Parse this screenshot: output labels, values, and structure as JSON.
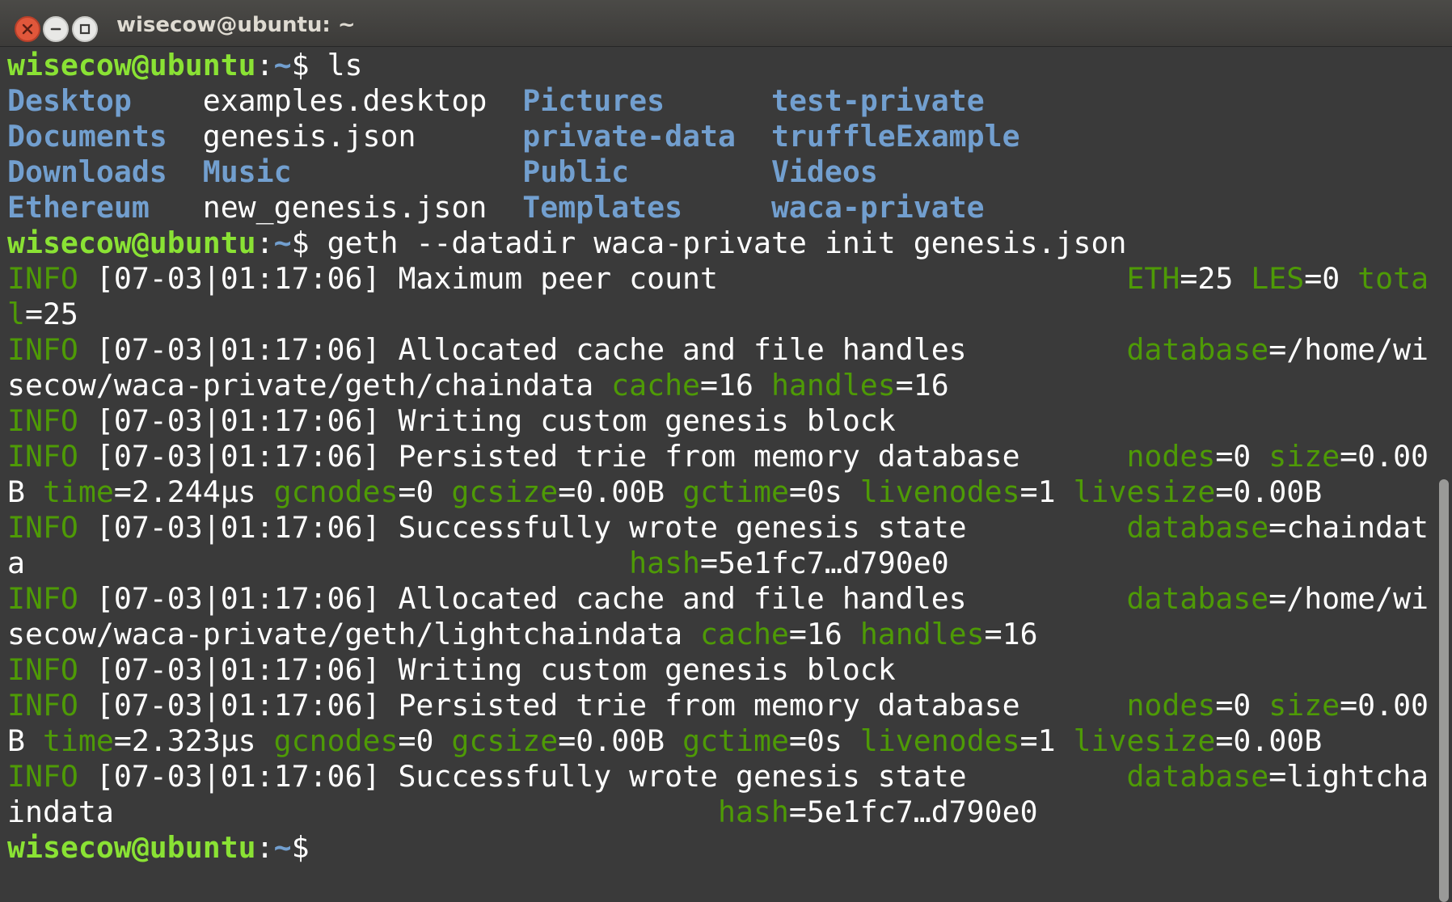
{
  "window": {
    "title": "wisecow@ubuntu: ~",
    "controls": [
      "close-icon",
      "minimize-icon",
      "maximize-icon"
    ]
  },
  "colors": {
    "background": "#3a3a3a",
    "prompt_user": "#8ae234",
    "prompt_path": "#729fcf",
    "directory": "#729fcf",
    "log_key": "#4e9a06",
    "text": "#ffffff"
  },
  "terminal": {
    "lines": [
      [
        {
          "t": "wisecow@ubuntu",
          "c": "prompt-user"
        },
        {
          "t": ":",
          "c": "c-plain"
        },
        {
          "t": "~",
          "c": "prompt-path"
        },
        {
          "t": "$ ls",
          "c": "c-plain"
        }
      ],
      [
        {
          "t": "Desktop    ",
          "c": "c-dir"
        },
        {
          "t": "examples.desktop  ",
          "c": "c-plain"
        },
        {
          "t": "Pictures",
          "c": "c-dir"
        },
        {
          "t": "      ",
          "c": "c-plain"
        },
        {
          "t": "test-private",
          "c": "c-dir"
        }
      ],
      [
        {
          "t": "Documents",
          "c": "c-dir"
        },
        {
          "t": "  genesis.json      ",
          "c": "c-plain"
        },
        {
          "t": "private-data",
          "c": "c-dir"
        },
        {
          "t": "  ",
          "c": "c-plain"
        },
        {
          "t": "truffleExample",
          "c": "c-dir"
        }
      ],
      [
        {
          "t": "Downloads",
          "c": "c-dir"
        },
        {
          "t": "  ",
          "c": "c-plain"
        },
        {
          "t": "Music",
          "c": "c-dir"
        },
        {
          "t": "             ",
          "c": "c-plain"
        },
        {
          "t": "Public",
          "c": "c-dir"
        },
        {
          "t": "        ",
          "c": "c-plain"
        },
        {
          "t": "Videos",
          "c": "c-dir"
        }
      ],
      [
        {
          "t": "Ethereum",
          "c": "c-dir"
        },
        {
          "t": "   new_genesis.json  ",
          "c": "c-plain"
        },
        {
          "t": "Templates",
          "c": "c-dir"
        },
        {
          "t": "     ",
          "c": "c-plain"
        },
        {
          "t": "waca-private",
          "c": "c-dir"
        }
      ],
      [
        {
          "t": "wisecow@ubuntu",
          "c": "prompt-user"
        },
        {
          "t": ":",
          "c": "c-plain"
        },
        {
          "t": "~",
          "c": "prompt-path"
        },
        {
          "t": "$ geth --datadir waca-private init genesis.json",
          "c": "c-plain"
        }
      ],
      [
        {
          "t": "INFO",
          "c": "c-green"
        },
        {
          "t": " [07-03|01:17:06] Maximum peer count                       ",
          "c": "c-plain"
        },
        {
          "t": "ETH",
          "c": "c-green"
        },
        {
          "t": "=25 ",
          "c": "c-plain"
        },
        {
          "t": "LES",
          "c": "c-green"
        },
        {
          "t": "=0 ",
          "c": "c-plain"
        },
        {
          "t": "tota",
          "c": "c-green"
        }
      ],
      [
        {
          "t": "l",
          "c": "c-green"
        },
        {
          "t": "=25",
          "c": "c-plain"
        }
      ],
      [
        {
          "t": "INFO",
          "c": "c-green"
        },
        {
          "t": " [07-03|01:17:06] Allocated cache and file handles         ",
          "c": "c-plain"
        },
        {
          "t": "database",
          "c": "c-green"
        },
        {
          "t": "=/home/wi",
          "c": "c-plain"
        }
      ],
      [
        {
          "t": "secow/waca-private/geth/chaindata ",
          "c": "c-plain"
        },
        {
          "t": "cache",
          "c": "c-green"
        },
        {
          "t": "=16 ",
          "c": "c-plain"
        },
        {
          "t": "handles",
          "c": "c-green"
        },
        {
          "t": "=16",
          "c": "c-plain"
        }
      ],
      [
        {
          "t": "INFO",
          "c": "c-green"
        },
        {
          "t": " [07-03|01:17:06] Writing custom genesis block",
          "c": "c-plain"
        }
      ],
      [
        {
          "t": "INFO",
          "c": "c-green"
        },
        {
          "t": " [07-03|01:17:06] Persisted trie from memory database      ",
          "c": "c-plain"
        },
        {
          "t": "nodes",
          "c": "c-green"
        },
        {
          "t": "=0 ",
          "c": "c-plain"
        },
        {
          "t": "size",
          "c": "c-green"
        },
        {
          "t": "=0.00",
          "c": "c-plain"
        }
      ],
      [
        {
          "t": "B ",
          "c": "c-plain"
        },
        {
          "t": "time",
          "c": "c-green"
        },
        {
          "t": "=2.244µs ",
          "c": "c-plain"
        },
        {
          "t": "gcnodes",
          "c": "c-green"
        },
        {
          "t": "=0 ",
          "c": "c-plain"
        },
        {
          "t": "gcsize",
          "c": "c-green"
        },
        {
          "t": "=0.00B ",
          "c": "c-plain"
        },
        {
          "t": "gctime",
          "c": "c-green"
        },
        {
          "t": "=0s ",
          "c": "c-plain"
        },
        {
          "t": "livenodes",
          "c": "c-green"
        },
        {
          "t": "=1 ",
          "c": "c-plain"
        },
        {
          "t": "livesize",
          "c": "c-green"
        },
        {
          "t": "=0.00B",
          "c": "c-plain"
        }
      ],
      [
        {
          "t": "INFO",
          "c": "c-green"
        },
        {
          "t": " [07-03|01:17:06] Successfully wrote genesis state         ",
          "c": "c-plain"
        },
        {
          "t": "database",
          "c": "c-green"
        },
        {
          "t": "=chaindat",
          "c": "c-plain"
        }
      ],
      [
        {
          "t": "a                                  ",
          "c": "c-plain"
        },
        {
          "t": "hash",
          "c": "c-green"
        },
        {
          "t": "=5e1fc7…d790e0",
          "c": "c-plain"
        }
      ],
      [
        {
          "t": "INFO",
          "c": "c-green"
        },
        {
          "t": " [07-03|01:17:06] Allocated cache and file handles         ",
          "c": "c-plain"
        },
        {
          "t": "database",
          "c": "c-green"
        },
        {
          "t": "=/home/wi",
          "c": "c-plain"
        }
      ],
      [
        {
          "t": "secow/waca-private/geth/lightchaindata ",
          "c": "c-plain"
        },
        {
          "t": "cache",
          "c": "c-green"
        },
        {
          "t": "=16 ",
          "c": "c-plain"
        },
        {
          "t": "handles",
          "c": "c-green"
        },
        {
          "t": "=16",
          "c": "c-plain"
        }
      ],
      [
        {
          "t": "INFO",
          "c": "c-green"
        },
        {
          "t": " [07-03|01:17:06] Writing custom genesis block",
          "c": "c-plain"
        }
      ],
      [
        {
          "t": "INFO",
          "c": "c-green"
        },
        {
          "t": " [07-03|01:17:06] Persisted trie from memory database      ",
          "c": "c-plain"
        },
        {
          "t": "nodes",
          "c": "c-green"
        },
        {
          "t": "=0 ",
          "c": "c-plain"
        },
        {
          "t": "size",
          "c": "c-green"
        },
        {
          "t": "=0.00",
          "c": "c-plain"
        }
      ],
      [
        {
          "t": "B ",
          "c": "c-plain"
        },
        {
          "t": "time",
          "c": "c-green"
        },
        {
          "t": "=2.323µs ",
          "c": "c-plain"
        },
        {
          "t": "gcnodes",
          "c": "c-green"
        },
        {
          "t": "=0 ",
          "c": "c-plain"
        },
        {
          "t": "gcsize",
          "c": "c-green"
        },
        {
          "t": "=0.00B ",
          "c": "c-plain"
        },
        {
          "t": "gctime",
          "c": "c-green"
        },
        {
          "t": "=0s ",
          "c": "c-plain"
        },
        {
          "t": "livenodes",
          "c": "c-green"
        },
        {
          "t": "=1 ",
          "c": "c-plain"
        },
        {
          "t": "livesize",
          "c": "c-green"
        },
        {
          "t": "=0.00B",
          "c": "c-plain"
        }
      ],
      [
        {
          "t": "INFO",
          "c": "c-green"
        },
        {
          "t": " [07-03|01:17:06] Successfully wrote genesis state         ",
          "c": "c-plain"
        },
        {
          "t": "database",
          "c": "c-green"
        },
        {
          "t": "=lightcha",
          "c": "c-plain"
        }
      ],
      [
        {
          "t": "indata                                  ",
          "c": "c-plain"
        },
        {
          "t": "hash",
          "c": "c-green"
        },
        {
          "t": "=5e1fc7…d790e0",
          "c": "c-plain"
        }
      ],
      [
        {
          "t": "wisecow@ubuntu",
          "c": "prompt-user"
        },
        {
          "t": ":",
          "c": "c-plain"
        },
        {
          "t": "~",
          "c": "prompt-path"
        },
        {
          "t": "$ ",
          "c": "c-plain"
        }
      ]
    ]
  }
}
